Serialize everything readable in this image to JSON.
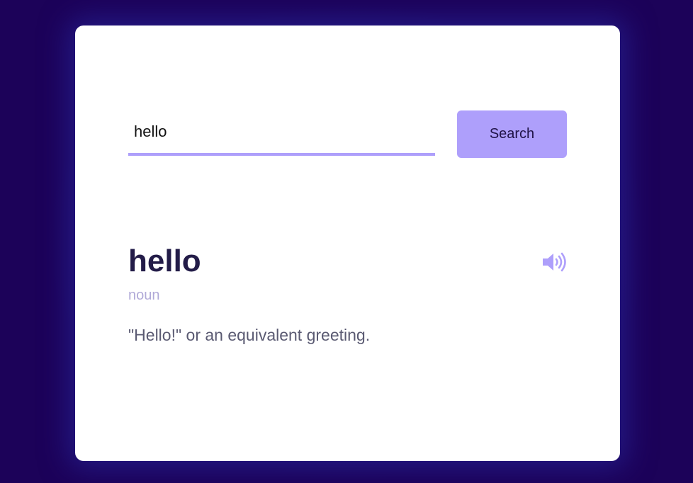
{
  "search": {
    "value": "hello",
    "button_label": "Search"
  },
  "result": {
    "word": "hello",
    "part_of_speech": "noun",
    "definition": "\"Hello!\" or an equivalent greeting.",
    "audio_icon": "speaker-volume-icon"
  },
  "colors": {
    "background": "#1c0259",
    "card": "#ffffff",
    "accent": "#ae9ffb",
    "word_text": "#231c48",
    "pos_text": "#b1aad8",
    "definition_text": "#5a5a72"
  }
}
